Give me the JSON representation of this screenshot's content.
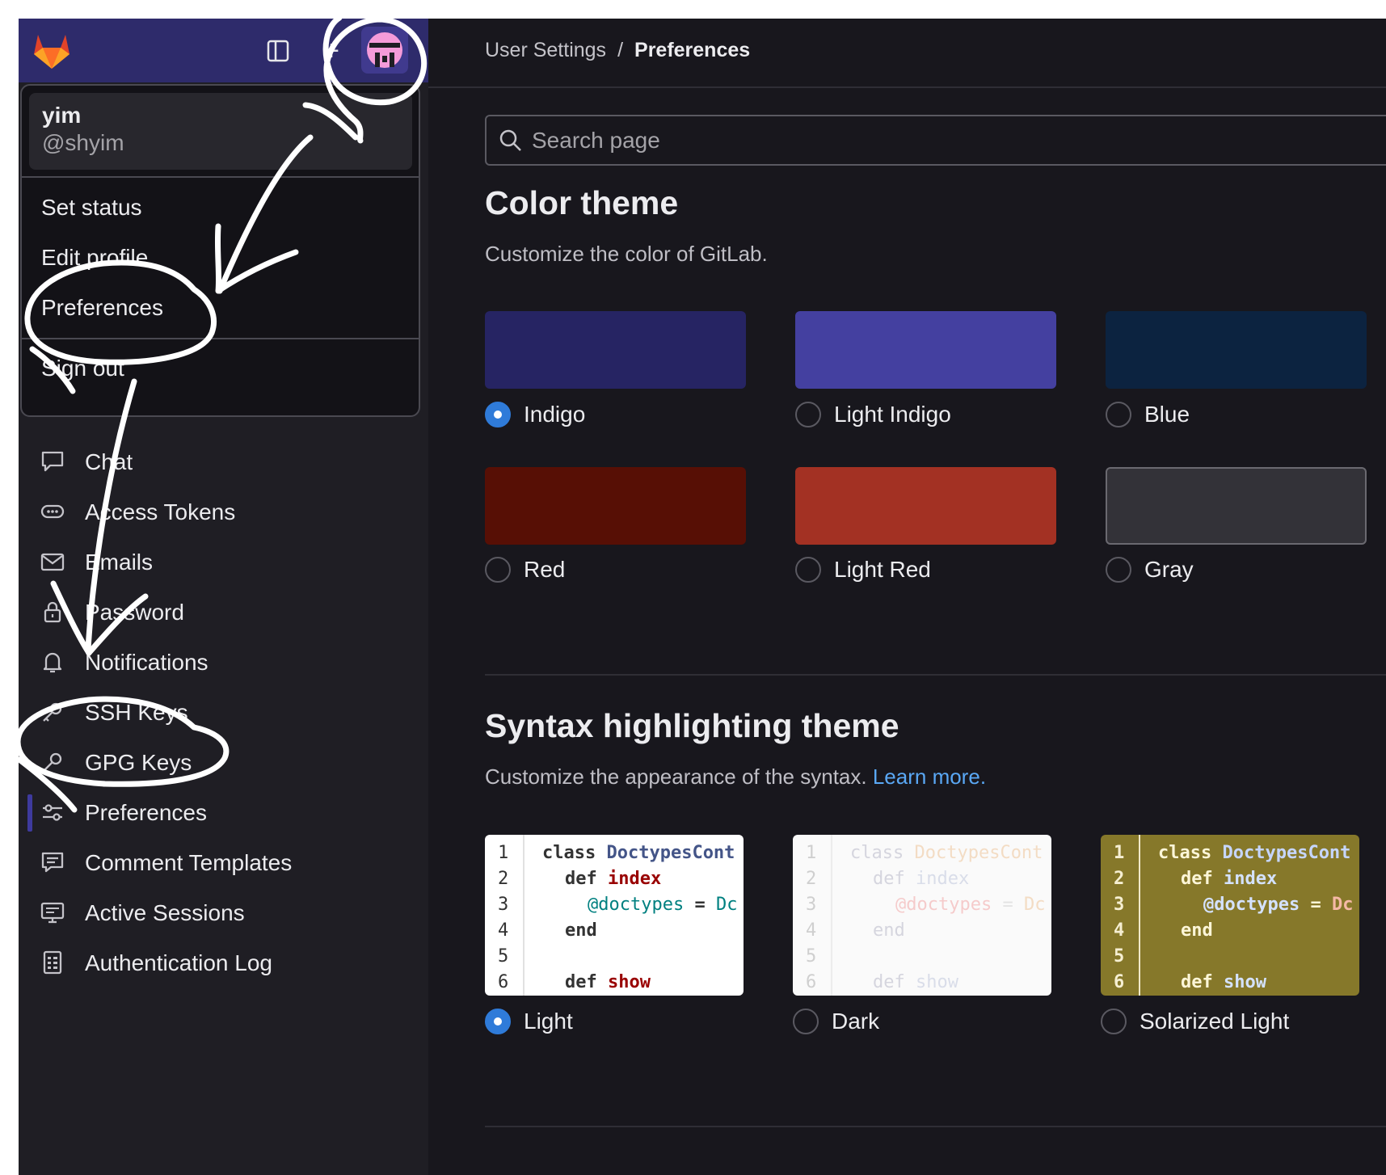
{
  "sidebar": {
    "user_menu": {
      "name": "yim",
      "handle": "@shyim",
      "items": [
        "Set status",
        "Edit profile",
        "Preferences",
        "Sign out"
      ]
    },
    "nav": [
      {
        "label": "Chat",
        "icon": "chat-icon"
      },
      {
        "label": "Access Tokens",
        "icon": "token-icon"
      },
      {
        "label": "Emails",
        "icon": "mail-icon"
      },
      {
        "label": "Password",
        "icon": "lock-icon"
      },
      {
        "label": "Notifications",
        "icon": "bell-icon"
      },
      {
        "label": "SSH Keys",
        "icon": "key-icon"
      },
      {
        "label": "GPG Keys",
        "icon": "gpg-key-icon"
      },
      {
        "label": "Preferences",
        "icon": "preferences-icon",
        "active": true
      },
      {
        "label": "Comment Templates",
        "icon": "comment-icon"
      },
      {
        "label": "Active Sessions",
        "icon": "monitor-icon"
      },
      {
        "label": "Authentication Log",
        "icon": "log-icon"
      }
    ]
  },
  "breadcrumb": {
    "parent": "User Settings",
    "separator": "/",
    "current": "Preferences"
  },
  "search": {
    "placeholder": "Search page"
  },
  "color_theme": {
    "title": "Color theme",
    "description": "Customize the color of GitLab.",
    "options": [
      {
        "label": "Indigo",
        "color": "#262463",
        "checked": true
      },
      {
        "label": "Light Indigo",
        "color": "#4440a0",
        "checked": false
      },
      {
        "label": "Blue",
        "color": "#0c2340",
        "checked": false
      },
      {
        "label": "Red",
        "color": "#570f05",
        "checked": false
      },
      {
        "label": "Light Red",
        "color": "#a33123",
        "checked": false
      },
      {
        "label": "Gray",
        "color": "#333238",
        "checked": false
      }
    ]
  },
  "syntax_theme": {
    "title": "Syntax highlighting theme",
    "description": "Customize the appearance of the syntax.",
    "learn_more": "Learn more",
    "period": ".",
    "line_numbers": [
      "1",
      "2",
      "3",
      "4",
      "5",
      "6"
    ],
    "code": {
      "l1_kw": "class",
      "l1_name": "DoctypesCont",
      "l2_kw": "def",
      "l2_name": "index",
      "l3_var": "@doctypes",
      "l3_op": "=",
      "l3_rest": "Dc",
      "l4_kw": "end",
      "l6_kw": "def",
      "l6_name": "show"
    },
    "options": [
      {
        "label": "Light",
        "checked": true
      },
      {
        "label": "Dark",
        "checked": false
      },
      {
        "label": "Solarized Light",
        "checked": false
      }
    ]
  }
}
